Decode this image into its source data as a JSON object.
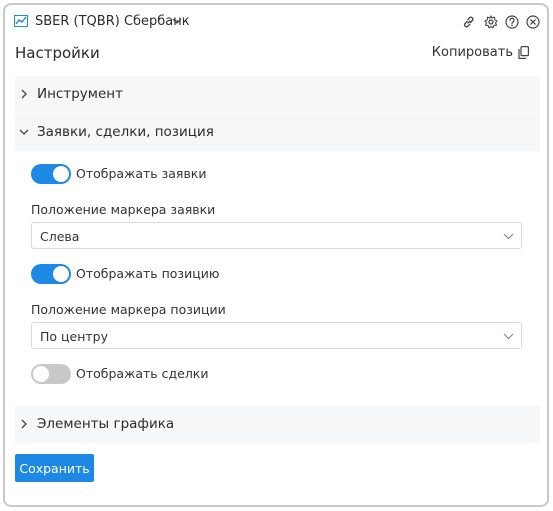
{
  "colors": {
    "accent": "#1e88e5",
    "toggle_off": "#c8c8c8",
    "section_bg": "#f5f7f9"
  },
  "window": {
    "title": "SBER (TQBR) Сбербанк",
    "title_icon": "chart-icon",
    "title_chevron": "chevron-down-icon",
    "actions": [
      "link-icon",
      "gear-icon",
      "help-icon",
      "close-icon"
    ]
  },
  "header": {
    "title": "Настройки",
    "copy_label": "Копировать",
    "copy_icon": "copy-icon"
  },
  "sections": [
    {
      "label": "Инструмент",
      "expanded": false
    },
    {
      "label": "Заявки, сделки, позиция",
      "expanded": true
    },
    {
      "label": "Элементы графика",
      "expanded": false
    }
  ],
  "orders_section": {
    "show_orders": {
      "label": "Отображать заявки",
      "on": true
    },
    "order_marker": {
      "label": "Положение маркера заявки",
      "value": "Слева"
    },
    "show_position": {
      "label": "Отображать позицию",
      "on": true
    },
    "position_marker": {
      "label": "Положение маркера позиции",
      "value": "По центру"
    },
    "show_trades": {
      "label": "Отображать сделки",
      "on": false
    }
  },
  "footer": {
    "save_label": "Сохранить"
  }
}
